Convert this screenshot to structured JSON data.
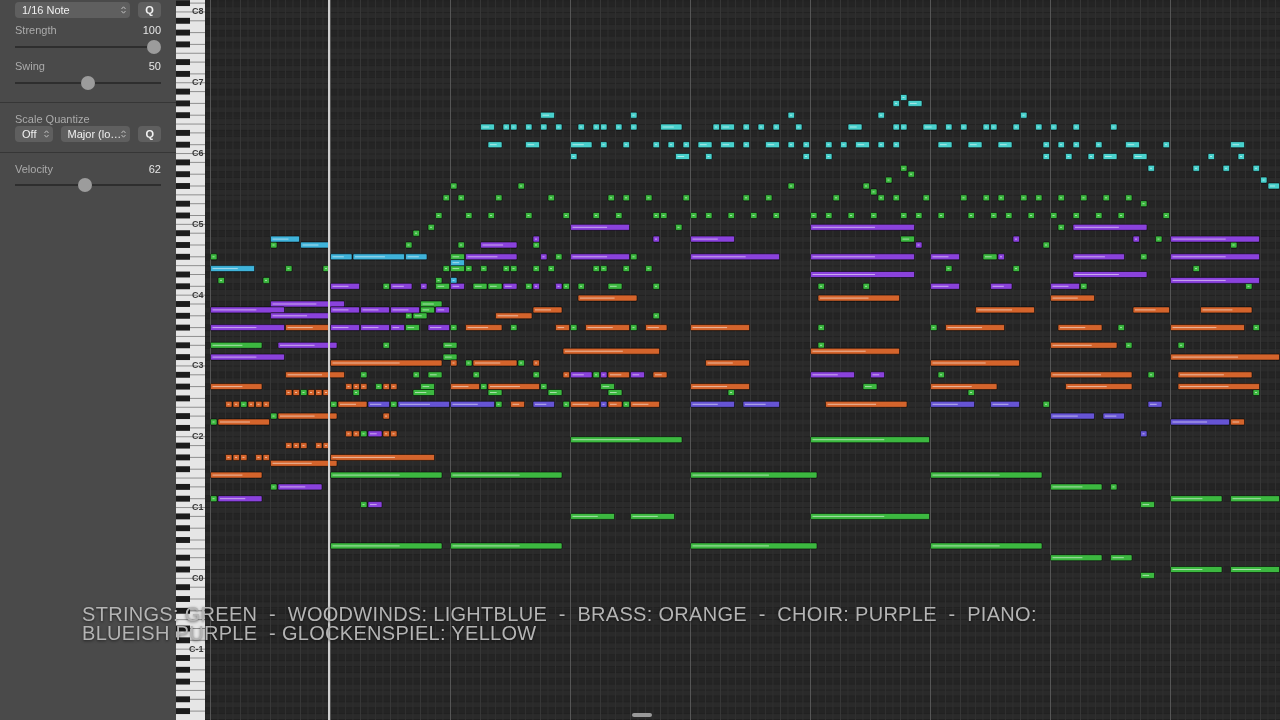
{
  "quantize": {
    "division": "1/16 Note",
    "apply_button": "Q",
    "sliders": [
      {
        "label": "Strength",
        "reading": "100",
        "level": 1
      },
      {
        "label": "Swing",
        "reading": "50",
        "level": 0.5
      }
    ]
  },
  "scale_quantize": {
    "label": "Scale Quantize",
    "mode": "Off",
    "scale": "Major (lo…",
    "apply_button": "Q"
  },
  "velocity": {
    "label": "Velocity",
    "reading": "62",
    "level": 0.48
  },
  "keyboard": {
    "labels": [
      "C8",
      "C7",
      "C6",
      "C5",
      "C4",
      "C3",
      "C2",
      "C1",
      "C0",
      "C-1"
    ]
  },
  "note_series": [
    {
      "color": "#48d0cc"
    },
    {
      "color": "#3cb840"
    },
    {
      "color": "#3fb3da"
    },
    {
      "color": "#d4642c"
    },
    {
      "color": "#8a42dc"
    },
    {
      "color": "#6654d4"
    }
  ],
  "caption": "STRINGS: GREEN  -  WOODWINDS: LIGHTBLUE  -  BRASS: ORANGE  -  CHOIR: PURPLE  -  PIANO: BLUEISH PURPLE  - GLOCKENSPIEL: YELLOW"
}
